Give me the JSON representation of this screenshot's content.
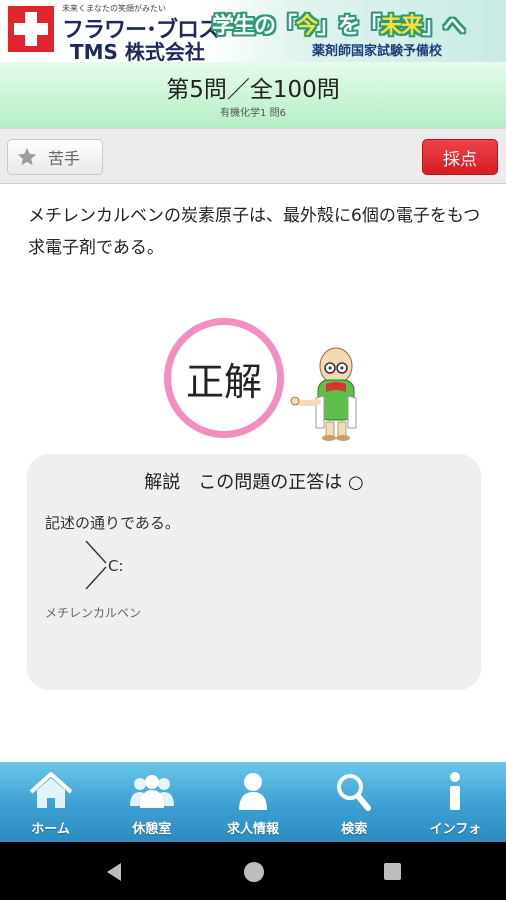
{
  "banner": {
    "tagline": "未来くまなたの笑顔がみたい",
    "brand_line1": "フラワー･ブロス",
    "brand_line2": "TMS 株式会社",
    "slogan_a": "学生の「",
    "slogan_b": "今",
    "slogan_c": "」を「",
    "slogan_d": "未来",
    "slogan_e": "」へ",
    "school": "薬剤師国家試験予備校"
  },
  "question_header": {
    "title": "第5問／全100問",
    "subtitle": "有機化学1 問6"
  },
  "toolbar": {
    "weak_label": "苦手",
    "grade_label": "採点"
  },
  "question": {
    "text": "メチレンカルベンの炭素原子は、最外殻に6個の電子をもつ求電子剤である。"
  },
  "result": {
    "label": "正解"
  },
  "explanation": {
    "title": "解説　この問題の正答は ○",
    "body": "記述の通りである。",
    "structure_label": "C:",
    "caption": "メチレンカルベン"
  },
  "bottom_nav": {
    "items": [
      {
        "label": "ホーム",
        "icon": "home-icon"
      },
      {
        "label": "休憩室",
        "icon": "people-icon"
      },
      {
        "label": "求人情報",
        "icon": "person-icon"
      },
      {
        "label": "検索",
        "icon": "search-icon"
      },
      {
        "label": "インフォ",
        "icon": "info-icon"
      }
    ]
  },
  "colors": {
    "header_green": "#b6eec5",
    "grade_red": "#e0262c",
    "result_pink": "#f28fc0",
    "nav_blue": "#3b9fd2"
  }
}
